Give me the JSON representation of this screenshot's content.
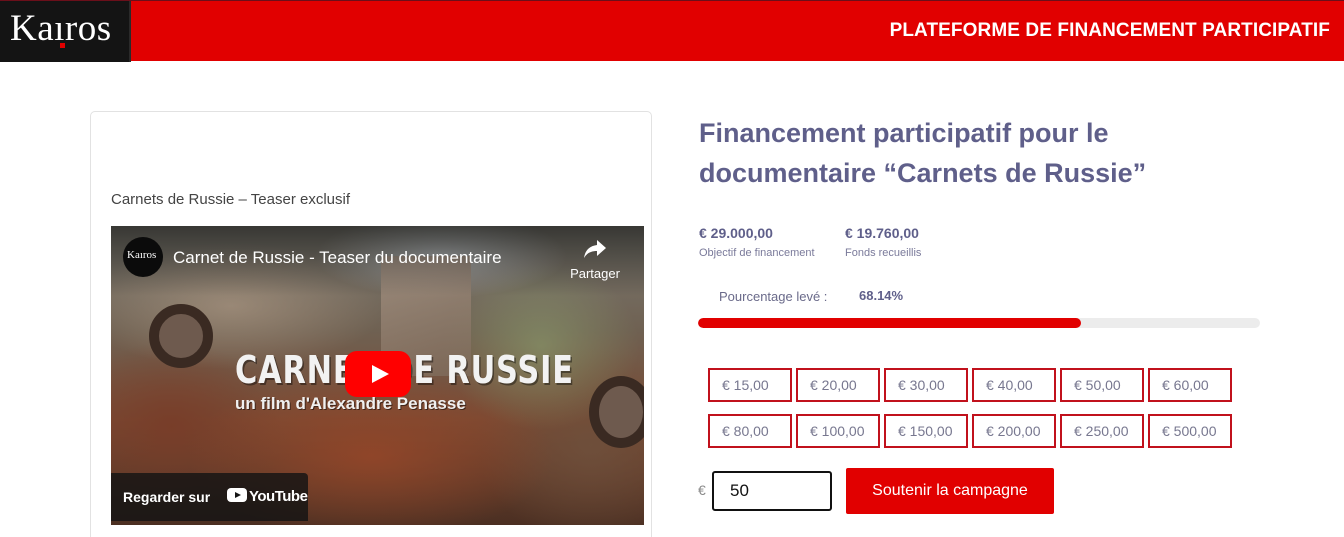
{
  "header": {
    "logo_text": "Kaıros",
    "title": "PLATEFORME DE FINANCEMENT PARTICIPATIF"
  },
  "video_card": {
    "caption": "Carnets de Russie – Teaser exclusif",
    "player": {
      "channel_avatar_text": "Kaıros",
      "title": "Carnet de Russie - Teaser du documentaire",
      "share_label": "Partager",
      "overlay_title": "CARNET DE RUSSIE",
      "overlay_subtitle": "un film d'Alexandre Penasse",
      "watch_on_label": "Regarder sur",
      "youtube_label": "YouTube"
    }
  },
  "campaign": {
    "title": "Financement participatif pour le documentaire “Carnets de Russie”",
    "goal_value": "€ 29.000,00",
    "goal_label": "Objectif de financement",
    "raised_value": "€ 19.760,00",
    "raised_label": "Fonds recueillis",
    "percent_label": "Pourcentage levé :",
    "percent_value": "68.14%",
    "percent_fraction": 0.6814
  },
  "donation": {
    "amounts": [
      "€ 15,00",
      "€ 20,00",
      "€ 30,00",
      "€ 40,00",
      "€ 50,00",
      "€ 60,00",
      "€ 80,00",
      "€ 100,00",
      "€ 150,00",
      "€ 200,00",
      "€ 250,00",
      "€ 500,00"
    ],
    "currency_symbol": "€",
    "input_value": "50",
    "submit_label": "Soutenir la campagne"
  },
  "colors": {
    "brand_red": "#e10000",
    "title_purple": "#5f5f8a"
  }
}
